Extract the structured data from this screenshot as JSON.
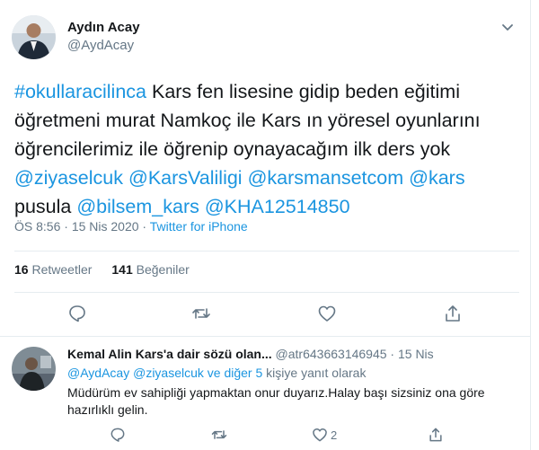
{
  "author": {
    "name": "Aydın Acay",
    "handle": "@AydAcay"
  },
  "tweet": {
    "hashtag": "#okullaracilinca",
    "line1_rest": " Kars fen lisesine gidip beden eğitimi",
    "line2": "öğretmeni murat Namkoç ile Kars ın yöresel oyunlarını",
    "line3": "öğrencilerimiz ile öğrenip oynayacağım ilk ders yok",
    "mention1": "@ziyaselcuk",
    "mention2": "@KarsValiligi",
    "mention3": "@karsmansetcom",
    "mention4": "@kars",
    "word_pusula": "pusula",
    "mention5": "@bilsem_kars",
    "mention6": "@KHA12514850"
  },
  "meta": {
    "time": "ÖS 8:56",
    "separator": " · ",
    "date": "15 Nis 2020",
    "source": "Twitter for iPhone"
  },
  "stats": {
    "retweets_count": "16",
    "retweets_label": "Retweetler",
    "likes_count": "141",
    "likes_label": "Beğeniler"
  },
  "actions": {
    "icons": [
      "reply-icon",
      "retweet-icon",
      "like-icon",
      "share-icon"
    ]
  },
  "reply": {
    "name": "Kemal Alin Kars'a dair sözü olan...",
    "handle": "@atr643663146945",
    "separator": " · ",
    "date": "15 Nis",
    "to_handle": "@AydAcay",
    "to_others": "@ziyaselcuk ve diğer 5",
    "to_suffix": " kişiye yanıt olarak",
    "text": "Müdürüm ev sahipliği yapmaktan onur duyarız.Halay başı sizsiniz ona göre hazırlıklı gelin.",
    "like_count": "2"
  },
  "colors": {
    "link": "#1b95e0",
    "secondary_text": "#657786",
    "divider": "#e6ecf0",
    "primary_text": "#14171a"
  }
}
